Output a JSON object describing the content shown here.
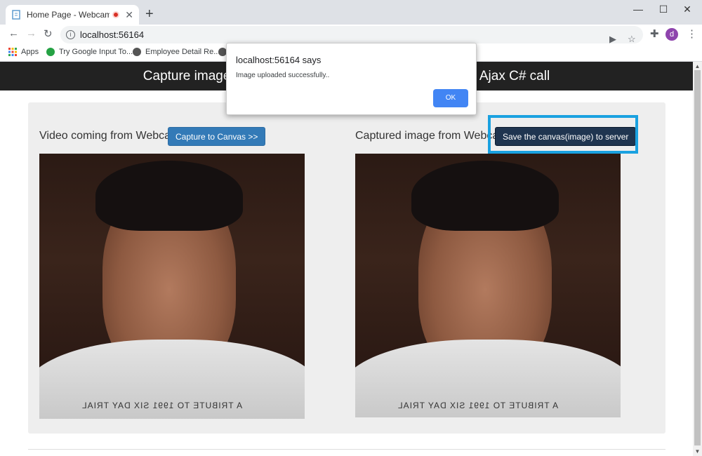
{
  "browser": {
    "tab_title": "Home Page - Webcam Captu",
    "url": "localhost:56164",
    "new_tab": "+",
    "bookmarks": [
      {
        "label": "Apps"
      },
      {
        "label": "Try Google Input To..."
      },
      {
        "label": "Employee Detail Re..."
      }
    ],
    "profile_initial": "d"
  },
  "page": {
    "header": "Capture image from Webcam and save it to server using Ajax C# call",
    "video_label": "Video coming from Webcam",
    "capture_button": "Capture to Canvas >>",
    "captured_label": "Captured image from Webcam",
    "save_button": "Save the canvas(image) to server",
    "shirt_text": "A TRIBUTE TO 1991 SIX DAY TRIAL"
  },
  "dialog": {
    "title": "localhost:56164 says",
    "message": "Image uploaded successfully..",
    "ok_label": "OK"
  },
  "colors": {
    "header_bg": "#222222",
    "capture_btn": "#337ab7",
    "save_btn": "#1f3550",
    "highlight": "#1aa1e0",
    "dialog_ok": "#4285f4"
  }
}
